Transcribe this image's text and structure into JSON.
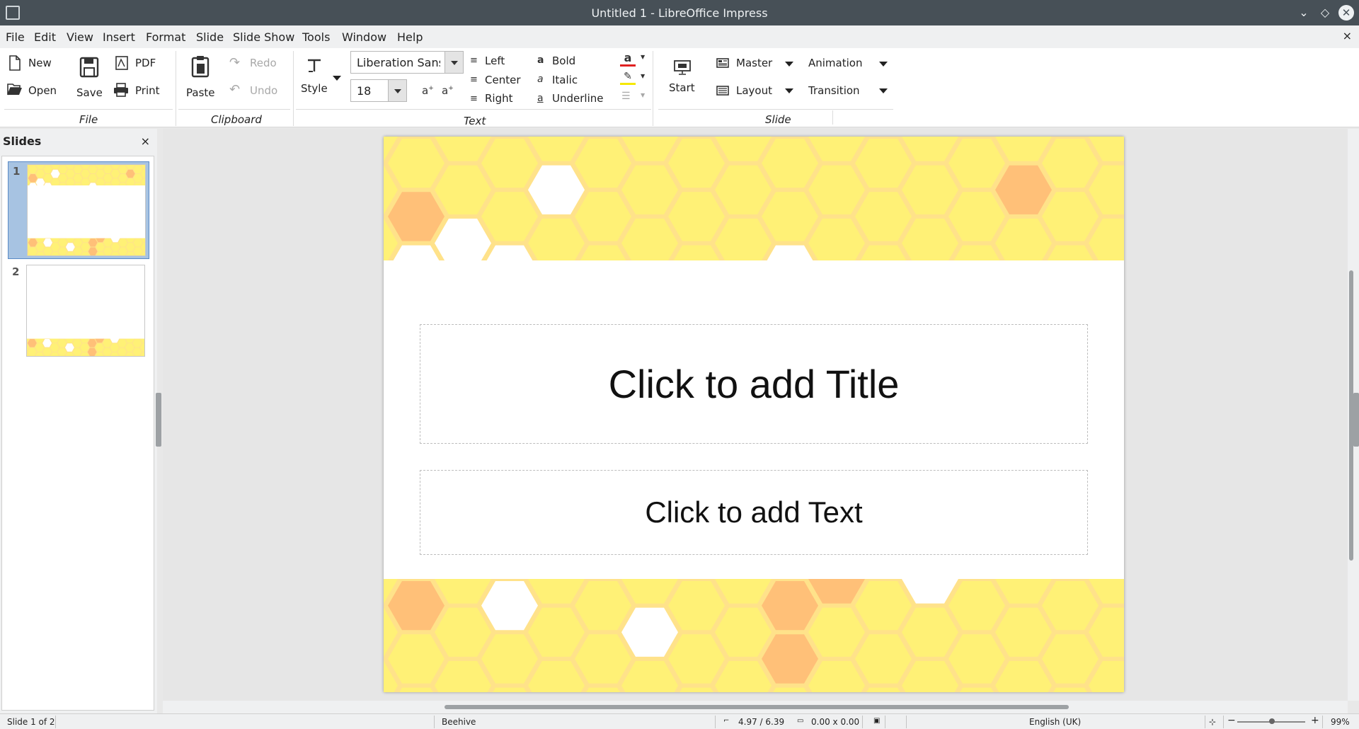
{
  "window": {
    "title": "Untitled 1 - LibreOffice Impress",
    "controls": [
      "minimize",
      "maximize",
      "close"
    ]
  },
  "menubar": {
    "items": [
      "File",
      "Edit",
      "View",
      "Insert",
      "Format",
      "Slide",
      "Slide Show",
      "Tools",
      "Window",
      "Help"
    ],
    "doc_close": "×"
  },
  "toolbar": {
    "file": {
      "group": "File",
      "new": "New",
      "open": "Open",
      "save": "Save",
      "pdf": "PDF",
      "print": "Print"
    },
    "clipboard": {
      "group": "Clipboard",
      "paste": "Paste",
      "redo": "Redo",
      "undo": "Undo"
    },
    "text": {
      "group": "Text",
      "style": "Style",
      "font_name": "Liberation Sans",
      "font_size": "18",
      "left": "Left",
      "center": "Center",
      "right": "Right",
      "bold": "Bold",
      "italic": "Italic",
      "underline": "Underline",
      "font_color": "#e02020",
      "highlight_color": "#f5e800"
    },
    "slide": {
      "group": "Slide",
      "start": "Start",
      "master": "Master",
      "layout": "Layout",
      "animation": "Animation",
      "transition": "Transition"
    }
  },
  "slides_panel": {
    "title": "Slides",
    "close": "×",
    "thumbnails": [
      {
        "number": "1",
        "selected": true
      },
      {
        "number": "2",
        "selected": false
      }
    ]
  },
  "slide": {
    "title_placeholder": "Click to add Title",
    "text_placeholder": "Click to add Text",
    "colors": {
      "yellow": "#fff176",
      "honey_edge": "#ffe28a",
      "orange": "#ffc078"
    }
  },
  "statusbar": {
    "slide_info": "Slide 1 of 2",
    "master": "Beehive",
    "position": "4.97 / 6.39",
    "size": "0.00 x 0.00",
    "language": "English (UK)",
    "zoom": "99%",
    "zoom_minus": "−",
    "zoom_plus": "+"
  }
}
